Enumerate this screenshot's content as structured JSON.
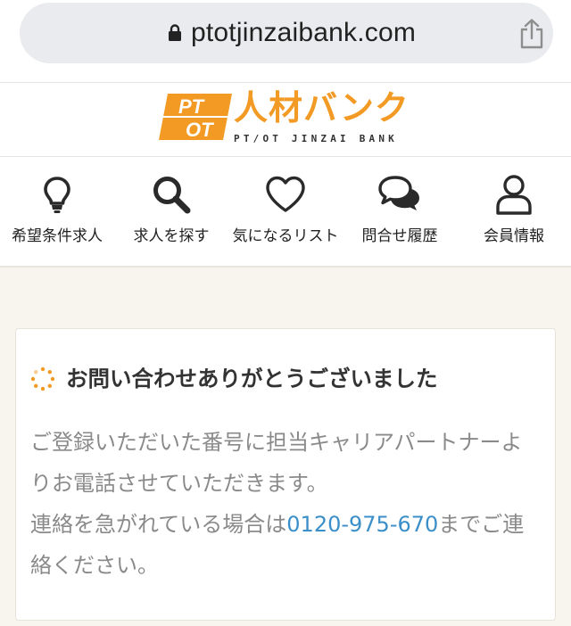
{
  "browser": {
    "url": "ptotjinzaibank.com",
    "lock_icon": "lock-icon",
    "share_icon": "share-icon"
  },
  "logo": {
    "badge_top": "PT",
    "badge_bottom": "OT",
    "main_text": "人材バンク",
    "sub_text": "PT/OT JINZAI BANK",
    "brand_color": "#f29a23"
  },
  "nav": {
    "items": [
      {
        "label": "希望条件求人",
        "icon": "lightbulb-icon"
      },
      {
        "label": "求人を探す",
        "icon": "search-icon"
      },
      {
        "label": "気になるリスト",
        "icon": "heart-icon"
      },
      {
        "label": "問合せ履歴",
        "icon": "chat-bubbles-icon"
      },
      {
        "label": "会員情報",
        "icon": "user-icon"
      }
    ]
  },
  "card": {
    "icon": "spinner-icon",
    "title": "お問い合わせありがとうございました",
    "body_line1": "ご登録いただいた番号に担当キャリアパートナーよりお電話させていただきます。",
    "body_line2_prefix": "連絡を急がれている場合は",
    "phone": "0120-975-670",
    "body_line2_suffix": "までご連絡ください。",
    "link_color": "#3b8fc8"
  }
}
